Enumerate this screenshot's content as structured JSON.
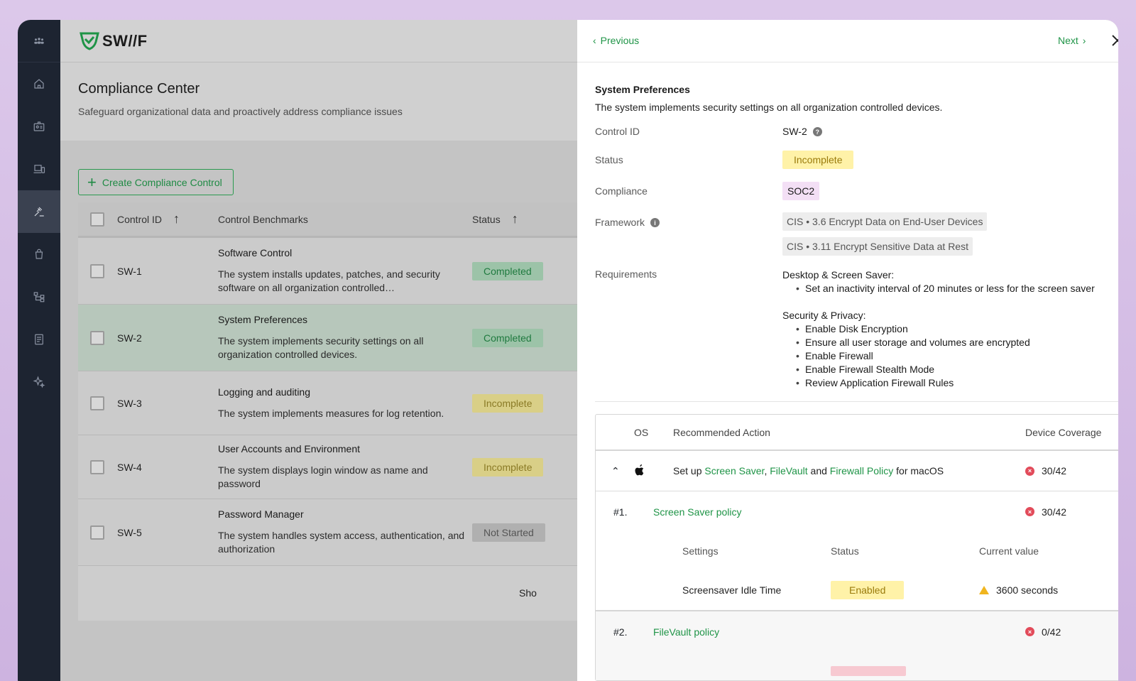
{
  "app": {
    "logo_text": "SW//F",
    "brand_color": "#1f9447"
  },
  "sidebar": {
    "items": [
      {
        "icon": "team-icon"
      },
      {
        "icon": "home-icon"
      },
      {
        "icon": "badge-icon"
      },
      {
        "icon": "devices-icon"
      },
      {
        "icon": "gavel-icon",
        "active": true
      },
      {
        "icon": "bag-icon"
      },
      {
        "icon": "hierarchy-icon"
      },
      {
        "icon": "report-icon"
      },
      {
        "icon": "sparkle-icon"
      }
    ]
  },
  "header": {
    "title": "Compliance Center",
    "subtitle": "Safeguard organizational data and proactively address compliance issues"
  },
  "toolbar": {
    "create_label": "Create Compliance Control"
  },
  "table": {
    "columns": {
      "id": "Control ID",
      "benchmarks": "Control Benchmarks",
      "status": "Status"
    },
    "rows": [
      {
        "id": "SW-1",
        "title": "Software Control",
        "desc": "The system installs updates, patches, and security software on all organization controlled…",
        "status": "Completed",
        "status_kind": "green"
      },
      {
        "id": "SW-2",
        "title": "System Preferences",
        "desc": "The system implements security settings on all organization controlled devices.",
        "status": "Completed",
        "status_kind": "green",
        "selected": true
      },
      {
        "id": "SW-3",
        "title": "Logging and auditing",
        "desc": "The system implements measures for log retention.",
        "status": "Incomplete",
        "status_kind": "yellow"
      },
      {
        "id": "SW-4",
        "title": "User Accounts and Environment",
        "desc": "The system displays login window as name and password",
        "status": "Incomplete",
        "status_kind": "yellow"
      },
      {
        "id": "SW-5",
        "title": "Password Manager",
        "desc": "The system handles system access, authentication, and authorization",
        "status": "Not Started",
        "status_kind": "grey"
      }
    ],
    "footer_text": "Sho"
  },
  "panel": {
    "prev_label": "Previous",
    "next_label": "Next",
    "title": "System Preferences",
    "description": "The system implements security settings on all organization controlled devices.",
    "fields": {
      "control_id_label": "Control ID",
      "control_id_value": "SW-2",
      "status_label": "Status",
      "status_value": "Incomplete",
      "compliance_label": "Compliance",
      "compliance_value": "SOC2",
      "framework_label": "Framework",
      "framework_values": [
        "CIS • 3.6 Encrypt Data on End-User Devices",
        "CIS • 3.11 Encrypt Sensitive Data at Rest"
      ],
      "requirements_label": "Requirements"
    },
    "requirements": [
      {
        "heading": "Desktop & Screen Saver:",
        "items": [
          "Set an inactivity interval of 20 minutes or less for the screen saver"
        ]
      },
      {
        "heading": "Security & Privacy:",
        "items": [
          "Enable Disk Encryption",
          "Ensure all user storage and volumes are encrypted",
          "Enable Firewall",
          "Enable Firewall Stealth Mode",
          "Review Application Firewall Rules"
        ]
      }
    ],
    "actions_table": {
      "col_os": "OS",
      "col_action": "Recommended Action",
      "col_coverage": "Device Coverage",
      "main_row": {
        "prefix": "Set up ",
        "link1": "Screen Saver",
        "sep1": ", ",
        "link2": "FileVault",
        "sep2": " and ",
        "link3": "Firewall Policy",
        "suffix": " for macOS",
        "coverage": "30/42"
      },
      "policies": [
        {
          "num": "#1.",
          "name": "Screen Saver policy",
          "coverage": "30/42"
        },
        {
          "num": "#2.",
          "name": "FileVault policy",
          "coverage": "0/42"
        }
      ],
      "settings_head": {
        "settings": "Settings",
        "status": "Status",
        "current": "Current value"
      },
      "setting_row": {
        "name": "Screensaver Idle Time",
        "status": "Enabled",
        "value": "3600 seconds"
      }
    }
  }
}
